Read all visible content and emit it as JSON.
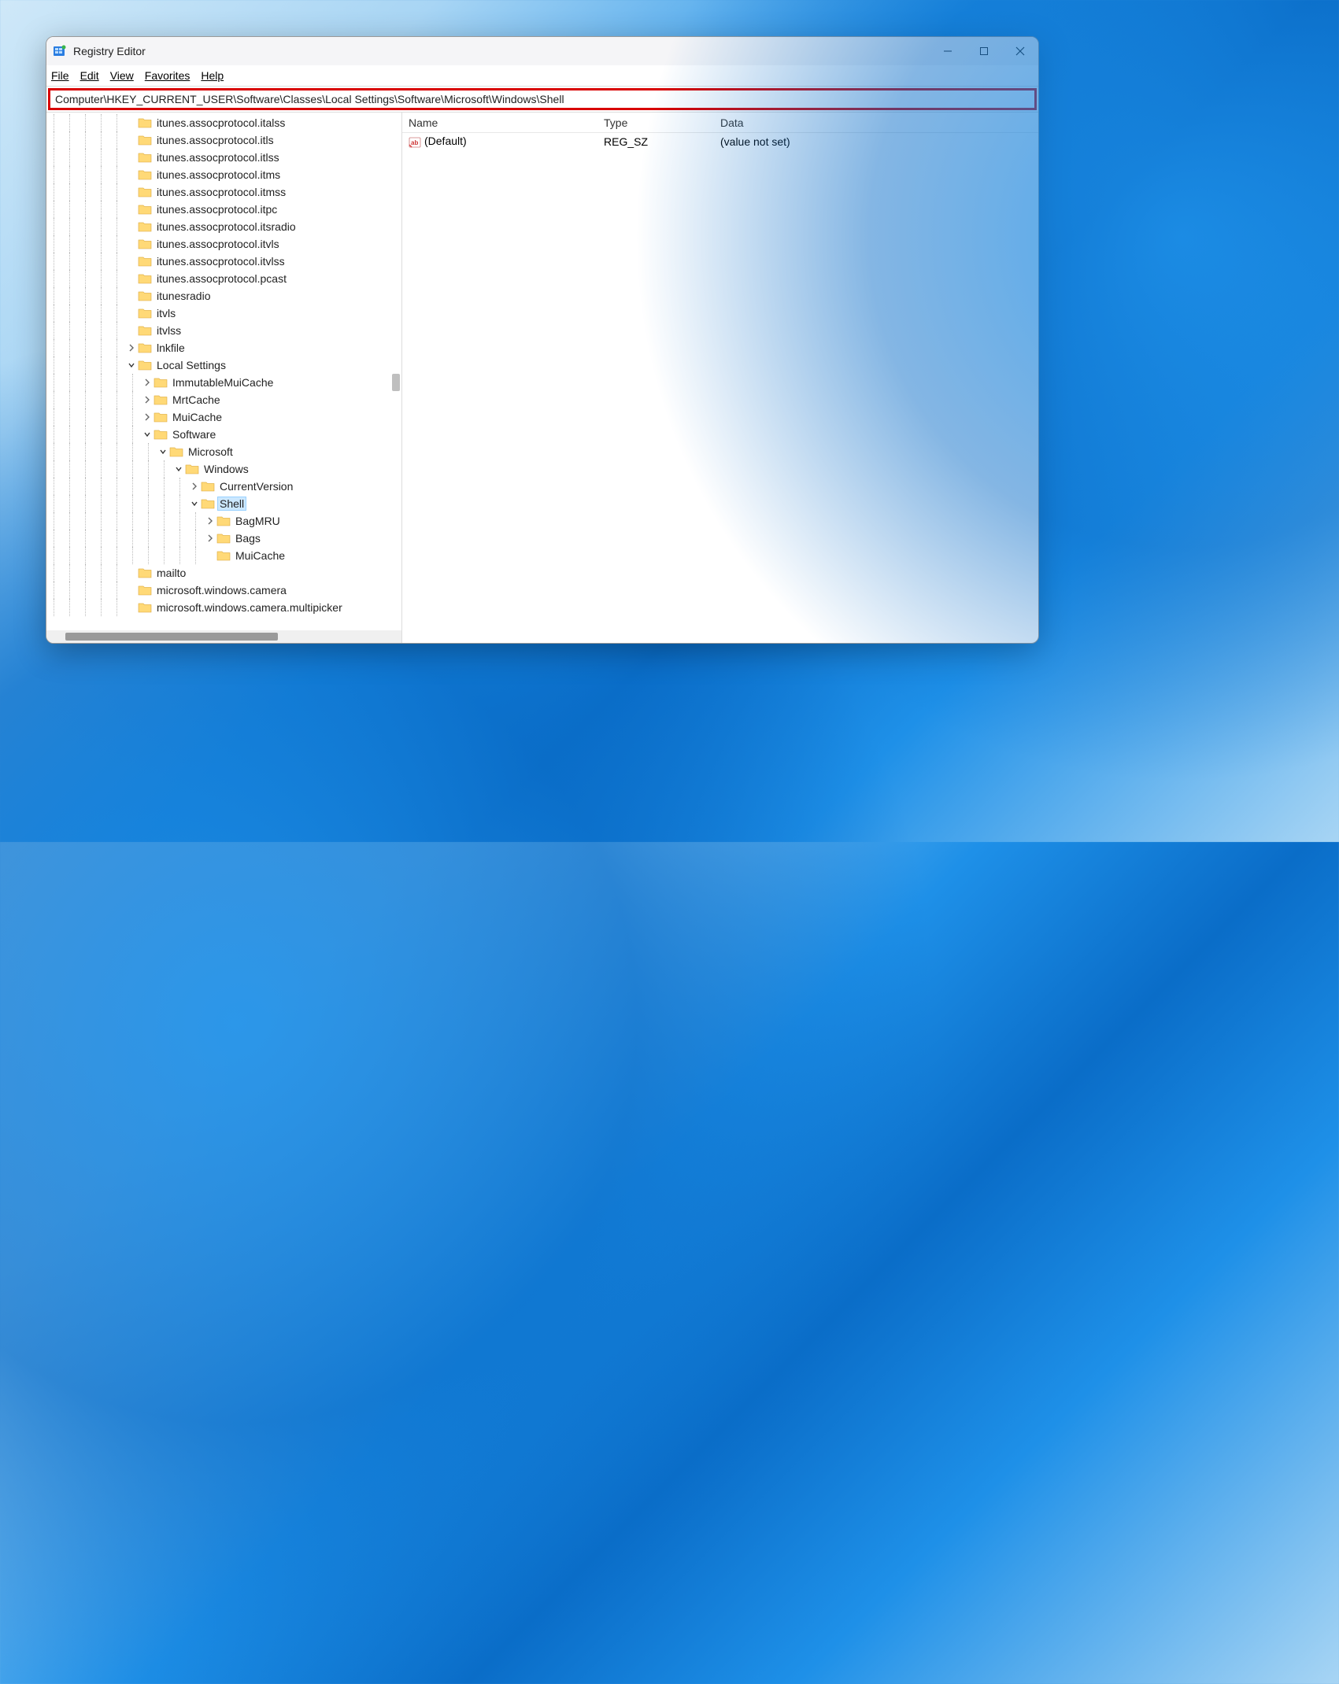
{
  "window": {
    "title": "Registry Editor"
  },
  "menu": {
    "file": "File",
    "edit": "Edit",
    "view": "View",
    "favorites": "Favorites",
    "help": "Help"
  },
  "address_path": "Computer\\HKEY_CURRENT_USER\\Software\\Classes\\Local Settings\\Software\\Microsoft\\Windows\\Shell",
  "tree": [
    {
      "indent": 5,
      "expander": "none",
      "label": "itunes.assocprotocol.italss"
    },
    {
      "indent": 5,
      "expander": "none",
      "label": "itunes.assocprotocol.itls"
    },
    {
      "indent": 5,
      "expander": "none",
      "label": "itunes.assocprotocol.itlss"
    },
    {
      "indent": 5,
      "expander": "none",
      "label": "itunes.assocprotocol.itms"
    },
    {
      "indent": 5,
      "expander": "none",
      "label": "itunes.assocprotocol.itmss"
    },
    {
      "indent": 5,
      "expander": "none",
      "label": "itunes.assocprotocol.itpc"
    },
    {
      "indent": 5,
      "expander": "none",
      "label": "itunes.assocprotocol.itsradio"
    },
    {
      "indent": 5,
      "expander": "none",
      "label": "itunes.assocprotocol.itvls"
    },
    {
      "indent": 5,
      "expander": "none",
      "label": "itunes.assocprotocol.itvlss"
    },
    {
      "indent": 5,
      "expander": "none",
      "label": "itunes.assocprotocol.pcast"
    },
    {
      "indent": 5,
      "expander": "none",
      "label": "itunesradio"
    },
    {
      "indent": 5,
      "expander": "none",
      "label": "itvls"
    },
    {
      "indent": 5,
      "expander": "none",
      "label": "itvlss"
    },
    {
      "indent": 5,
      "expander": "closed",
      "label": "lnkfile"
    },
    {
      "indent": 5,
      "expander": "open",
      "label": "Local Settings"
    },
    {
      "indent": 6,
      "expander": "closed",
      "label": "ImmutableMuiCache"
    },
    {
      "indent": 6,
      "expander": "closed",
      "label": "MrtCache"
    },
    {
      "indent": 6,
      "expander": "closed",
      "label": "MuiCache"
    },
    {
      "indent": 6,
      "expander": "open",
      "label": "Software"
    },
    {
      "indent": 7,
      "expander": "open",
      "label": "Microsoft"
    },
    {
      "indent": 8,
      "expander": "open",
      "label": "Windows"
    },
    {
      "indent": 9,
      "expander": "closed",
      "label": "CurrentVersion"
    },
    {
      "indent": 9,
      "expander": "open",
      "label": "Shell",
      "selected": true
    },
    {
      "indent": 10,
      "expander": "closed",
      "label": "BagMRU"
    },
    {
      "indent": 10,
      "expander": "closed",
      "label": "Bags"
    },
    {
      "indent": 10,
      "expander": "none",
      "label": "MuiCache"
    },
    {
      "indent": 5,
      "expander": "none",
      "label": "mailto"
    },
    {
      "indent": 5,
      "expander": "none",
      "label": "microsoft.windows.camera"
    },
    {
      "indent": 5,
      "expander": "none",
      "label": "microsoft.windows.camera.multipicker"
    }
  ],
  "list": {
    "columns": {
      "name": "Name",
      "type": "Type",
      "data": "Data"
    },
    "rows": [
      {
        "name": "(Default)",
        "type": "REG_SZ",
        "data": "(value not set)"
      }
    ]
  }
}
